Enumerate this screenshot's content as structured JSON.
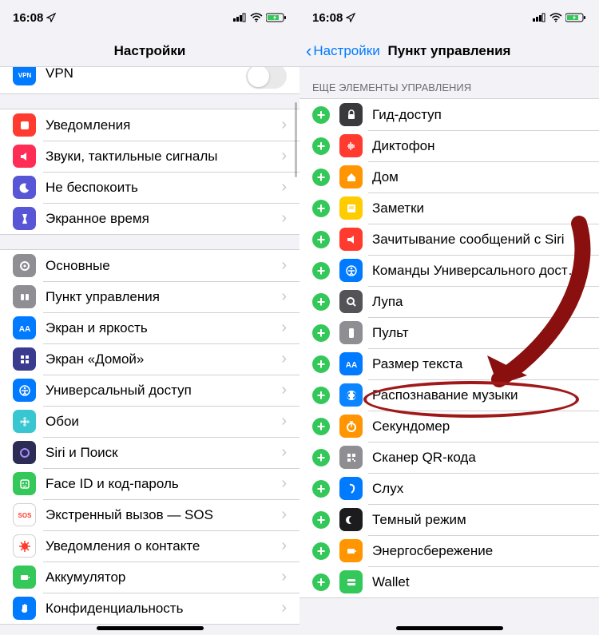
{
  "status": {
    "time": "16:08"
  },
  "left": {
    "title": "Настройки",
    "vpn": "VPN",
    "g1": [
      {
        "label": "Уведомления",
        "bg": "#ff3b30",
        "glyph": "notif"
      },
      {
        "label": "Звуки, тактильные сигналы",
        "bg": "#ff2d55",
        "glyph": "sound"
      },
      {
        "label": "Не беспокоить",
        "bg": "#5856d6",
        "glyph": "moon"
      },
      {
        "label": "Экранное время",
        "bg": "#5856d6",
        "glyph": "hour"
      }
    ],
    "g2": [
      {
        "label": "Основные",
        "bg": "#8e8e93",
        "glyph": "gear"
      },
      {
        "label": "Пункт управления",
        "bg": "#8e8e93",
        "glyph": "cc"
      },
      {
        "label": "Экран и яркость",
        "bg": "#007aff",
        "glyph": "aa"
      },
      {
        "label": "Экран «Домой»",
        "bg": "#3a3a8f",
        "glyph": "grid"
      },
      {
        "label": "Универсальный доступ",
        "bg": "#007aff",
        "glyph": "acc"
      },
      {
        "label": "Обои",
        "bg": "#38c7d1",
        "glyph": "flower"
      },
      {
        "label": "Siri и Поиск",
        "bg": "#2c2c54",
        "glyph": "siri"
      },
      {
        "label": "Face ID и код-пароль",
        "bg": "#34c759",
        "glyph": "face"
      },
      {
        "label": "Экстренный вызов — SOS",
        "bg": "#ffffff",
        "glyph": "sos"
      },
      {
        "label": "Уведомления о контакте",
        "bg": "#ffffff",
        "glyph": "covid"
      },
      {
        "label": "Аккумулятор",
        "bg": "#34c759",
        "glyph": "batt"
      },
      {
        "label": "Конфиденциальность",
        "bg": "#007aff",
        "glyph": "hand"
      }
    ]
  },
  "right": {
    "back": "Настройки",
    "title": "Пункт управления",
    "section": "ЕЩЕ ЭЛЕМЕНТЫ УПРАВЛЕНИЯ",
    "items": [
      {
        "label": "Гид-доступ",
        "bg": "#3a3a3c",
        "glyph": "lock"
      },
      {
        "label": "Диктофон",
        "bg": "#ff3b30",
        "glyph": "wave"
      },
      {
        "label": "Дом",
        "bg": "#ff9500",
        "glyph": "home"
      },
      {
        "label": "Заметки",
        "bg": "#ffcc00",
        "glyph": "note"
      },
      {
        "label": "Зачитывание сообщений с Siri",
        "bg": "#ff3b30",
        "glyph": "ann"
      },
      {
        "label": "Команды Универсального доступа",
        "bg": "#007aff",
        "glyph": "acc"
      },
      {
        "label": "Лупа",
        "bg": "#545458",
        "glyph": "mag"
      },
      {
        "label": "Пульт",
        "bg": "#8e8e93",
        "glyph": "remote"
      },
      {
        "label": "Размер текста",
        "bg": "#007aff",
        "glyph": "aa"
      },
      {
        "label": "Распознавание музыки",
        "bg": "#0a84ff",
        "glyph": "shazam"
      },
      {
        "label": "Секундомер",
        "bg": "#ff9500",
        "glyph": "stop"
      },
      {
        "label": "Сканер QR-кода",
        "bg": "#8e8e93",
        "glyph": "qr"
      },
      {
        "label": "Слух",
        "bg": "#007aff",
        "glyph": "ear"
      },
      {
        "label": "Темный режим",
        "bg": "#1c1c1e",
        "glyph": "dark"
      },
      {
        "label": "Энергосбережение",
        "bg": "#ff9500",
        "glyph": "lowbatt"
      },
      {
        "label": "Wallet",
        "bg": "#34c759",
        "glyph": "wallet"
      }
    ]
  }
}
